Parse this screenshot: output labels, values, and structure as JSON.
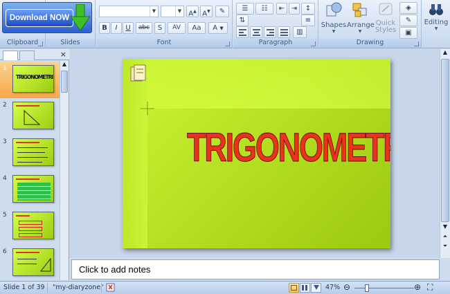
{
  "ribbon": {
    "download_label": "Download NOW",
    "groups": {
      "clipboard": "Clipboard",
      "slides": "Slides",
      "font": "Font",
      "paragraph": "Paragraph",
      "drawing": "Drawing"
    },
    "font_buttons": [
      "B",
      "I",
      "U",
      "abc",
      "S",
      "AV",
      "Aa",
      "A"
    ],
    "font_size_buttons": [
      "A",
      "A"
    ],
    "drawing": {
      "shapes": "Shapes",
      "arrange": "Arrange",
      "quick_styles": "Quick Styles"
    },
    "editing": "Editing"
  },
  "slides_pane": {
    "close": "×",
    "thumbnails": [
      {
        "num": "1",
        "title": "TRIGONOMETRI",
        "selected": true
      },
      {
        "num": "2",
        "title": "",
        "selected": false
      },
      {
        "num": "3",
        "title": "",
        "selected": false
      },
      {
        "num": "4",
        "title": "",
        "selected": false
      },
      {
        "num": "5",
        "title": "",
        "selected": false
      },
      {
        "num": "6",
        "title": "",
        "selected": false
      }
    ]
  },
  "slide": {
    "title": "TRIGONOMETRI",
    "title_color": "#e8341c",
    "background": "#c8f534"
  },
  "notes": {
    "placeholder": "Click to add notes"
  },
  "status": {
    "slide_info": "Slide 1 of 39",
    "theme": "\"my-diaryzone\"",
    "zoom": "47%",
    "zoom_level": 0.47
  }
}
